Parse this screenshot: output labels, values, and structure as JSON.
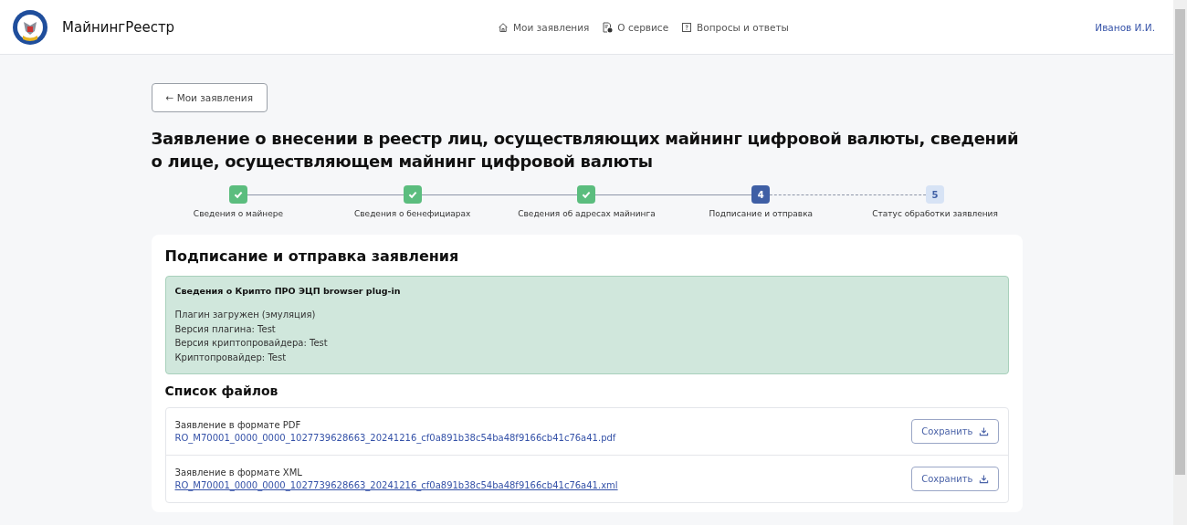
{
  "header": {
    "brand": "МайнингРеестр",
    "nav": [
      {
        "label": "Мои заявления"
      },
      {
        "label": "О сервисе"
      },
      {
        "label": "Вопросы и ответы"
      }
    ],
    "user": "Иванов И.И."
  },
  "back_button": "← Мои заявления",
  "title": "Заявление о внесении в реестр лиц, осуществляющих майнинг цифровой валюты, сведений о лице, осуществляющем майнинг цифровой валюты",
  "steps": [
    {
      "label": "Сведения о майнере",
      "completed": true,
      "selected": false
    },
    {
      "label": "Сведения о бенефициарах",
      "completed": true,
      "selected": false
    },
    {
      "label": "Сведения об адресах майнинга",
      "completed": true,
      "selected": false
    },
    {
      "number": "4",
      "label": "Подписание и отправка",
      "completed": false,
      "selected": true
    },
    {
      "number": "5",
      "label": "Статус обработки заявления",
      "completed": false,
      "selected": false
    }
  ],
  "card": {
    "heading": "Подписание и отправка заявления",
    "plugin_info": {
      "title": "Сведения о Крипто ПРО ЭЦП browser plug-in",
      "lines": [
        "Плагин загружен (эмуляция)",
        "Версия плагина: Test",
        "Версия криптопровайдера: Test",
        "Криптопровайдер: Test"
      ]
    },
    "files_heading": "Список файлов",
    "files": [
      {
        "label": "Заявление в формате PDF",
        "filename": "RO_M70001_0000_0000_1027739628663_20241216_cf0a891b38c54ba48f9166cb41c76a41.pdf",
        "underlined": false,
        "button": "Сохранить"
      },
      {
        "label": "Заявление в формате XML",
        "filename": "RO_M70001_0000_0000_1027739628663_20241216_cf0a891b38c54ba48f9166cb41c76a41.xml",
        "underlined": true,
        "button": "Сохранить"
      }
    ]
  }
}
